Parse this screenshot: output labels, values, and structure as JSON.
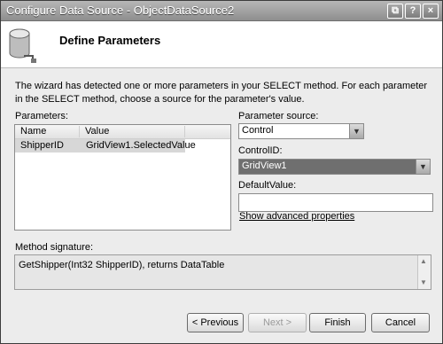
{
  "window": {
    "title": "Configure Data Source - ObjectDataSource2",
    "buttons": [
      "⧉",
      "?",
      "×"
    ]
  },
  "header": {
    "title": "Define Parameters"
  },
  "description": "The wizard has detected one or more parameters in your SELECT method. For each parameter in the SELECT method, choose a source for the parameter's value.",
  "parameters": {
    "label": "Parameters:",
    "columns": [
      "Name",
      "Value"
    ],
    "rows": [
      {
        "name": "ShipperID",
        "value": "GridView1.SelectedValue"
      }
    ]
  },
  "parameter_source": {
    "label": "Parameter source:",
    "value": "Control"
  },
  "control_id": {
    "label": "ControlID:",
    "value": "GridView1"
  },
  "default_value": {
    "label": "DefaultValue:",
    "value": ""
  },
  "advanced_link": "Show advanced properties",
  "method_signature": {
    "label": "Method signature:",
    "value": "GetShipper(Int32 ShipperID), returns DataTable"
  },
  "footer": {
    "previous": "< Previous",
    "next": "Next >",
    "finish": "Finish",
    "cancel": "Cancel"
  }
}
